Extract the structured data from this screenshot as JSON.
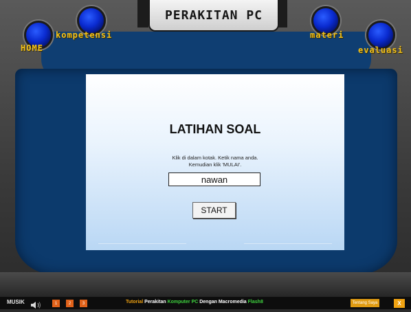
{
  "header": {
    "title": "PERAKITAN PC",
    "nav": {
      "home": "HOME",
      "kompetensi": "kompetensi",
      "materi": "materi",
      "evaluasi": "evaluasi"
    }
  },
  "quiz": {
    "title": "LATIHAN SOAL",
    "instruction": "Klik di dalam kotak. Ketik nama anda. Kemudian klik 'MULAI'.",
    "name_value": "nawan",
    "start_label": "START"
  },
  "footer": {
    "musik_label": "MUSIK",
    "music_buttons": [
      "1",
      "2",
      "3"
    ],
    "tagline": {
      "part1": "Tutorial ",
      "part2": "Perakitan ",
      "part3": "Komputer PC ",
      "part4": "Dengan Macromedia ",
      "part5": "Flash8"
    },
    "about_label": "Tentang Saya",
    "close_label": "X"
  },
  "colors": {
    "accent_yellow": "#f3c21c",
    "frame_blue": "#0c3a6c",
    "footer_orange": "#e1621a",
    "tagline_orange": "#f0a312",
    "tagline_green": "#3fd43f"
  }
}
